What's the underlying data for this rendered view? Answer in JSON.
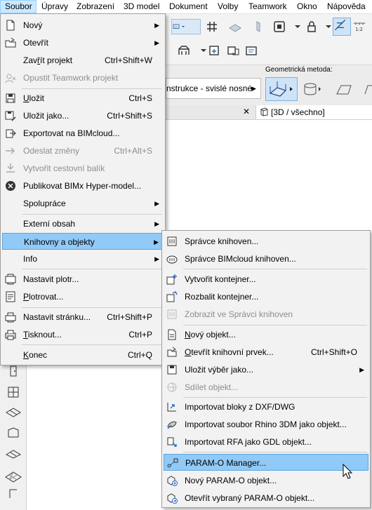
{
  "menubar": {
    "items": [
      "Soubor",
      "Úpravy",
      "Zobrazení",
      "3D model",
      "Dokument",
      "Volby",
      "Teamwork",
      "Okno",
      "Nápověda"
    ]
  },
  "infobox": {
    "construction_label": "nstrukce - svislé nosné",
    "geometry_method_label": "Geometrická metoda:"
  },
  "tabbar": {
    "view_tab": "[3D / všechno]"
  },
  "file_menu": {
    "items": [
      {
        "label": "Nový",
        "shortcut": "",
        "submenu": true,
        "disabled": false
      },
      {
        "label": "Otevřít",
        "shortcut": "",
        "submenu": true,
        "disabled": false
      },
      {
        "label": "Zavřít projekt",
        "shortcut": "Ctrl+Shift+W",
        "submenu": false,
        "disabled": false
      },
      {
        "label": "Opustit Teamwork projekt",
        "shortcut": "",
        "submenu": false,
        "disabled": true
      },
      {
        "label": "Uložit",
        "shortcut": "Ctrl+S",
        "submenu": false,
        "disabled": false
      },
      {
        "label": "Uložit jako...",
        "shortcut": "Ctrl+Shift+S",
        "submenu": false,
        "disabled": false
      },
      {
        "label": "Exportovat na BIMcloud...",
        "shortcut": "",
        "submenu": false,
        "disabled": false
      },
      {
        "label": "Odeslat změny",
        "shortcut": "Ctrl+Alt+S",
        "submenu": false,
        "disabled": true
      },
      {
        "label": "Vytvořit cestovní balík",
        "shortcut": "",
        "submenu": false,
        "disabled": true
      },
      {
        "label": "Publikovat BIMx Hyper-model...",
        "shortcut": "",
        "submenu": false,
        "disabled": false
      },
      {
        "label": "Spolupráce",
        "shortcut": "",
        "submenu": true,
        "disabled": false
      },
      {
        "label": "Externí obsah",
        "shortcut": "",
        "submenu": true,
        "disabled": false
      },
      {
        "label": "Knihovny a objekty",
        "shortcut": "",
        "submenu": true,
        "disabled": false
      },
      {
        "label": "Info",
        "shortcut": "",
        "submenu": true,
        "disabled": false
      },
      {
        "label": "Nastavit plotr...",
        "shortcut": "",
        "submenu": false,
        "disabled": false
      },
      {
        "label": "Plotrovat...",
        "shortcut": "",
        "submenu": false,
        "disabled": false
      },
      {
        "label": "Nastavit stránku...",
        "shortcut": "Ctrl+Shift+P",
        "submenu": false,
        "disabled": false
      },
      {
        "label": "Tisknout...",
        "shortcut": "Ctrl+P",
        "submenu": false,
        "disabled": false
      },
      {
        "label": "Konec",
        "shortcut": "Ctrl+Q",
        "submenu": false,
        "disabled": false
      }
    ]
  },
  "library_menu": {
    "items": [
      {
        "label": "Správce knihoven...",
        "shortcut": "",
        "submenu": false,
        "disabled": false
      },
      {
        "label": "Správce BIMcloud knihoven...",
        "shortcut": "",
        "submenu": false,
        "disabled": false
      },
      {
        "label": "Vytvořit kontejner...",
        "shortcut": "",
        "submenu": false,
        "disabled": false
      },
      {
        "label": "Rozbalit kontejner...",
        "shortcut": "",
        "submenu": false,
        "disabled": false
      },
      {
        "label": "Zobrazit ve Správci knihoven",
        "shortcut": "",
        "submenu": false,
        "disabled": true
      },
      {
        "label": "Nový objekt...",
        "shortcut": "",
        "submenu": false,
        "disabled": false
      },
      {
        "label": "Otevřít knihovní prvek...",
        "shortcut": "Ctrl+Shift+O",
        "submenu": false,
        "disabled": false
      },
      {
        "label": "Uložit výběr jako...",
        "shortcut": "",
        "submenu": true,
        "disabled": false
      },
      {
        "label": "Sdílet objekt...",
        "shortcut": "",
        "submenu": false,
        "disabled": true
      },
      {
        "label": "Importovat bloky z DXF/DWG",
        "shortcut": "",
        "submenu": false,
        "disabled": false
      },
      {
        "label": "Importovat soubor Rhino 3DM jako objekt...",
        "shortcut": "",
        "submenu": false,
        "disabled": false
      },
      {
        "label": "Importovat RFA jako GDL objekt...",
        "shortcut": "",
        "submenu": false,
        "disabled": false
      },
      {
        "label": "PARAM-O Manager...",
        "shortcut": "",
        "submenu": false,
        "disabled": false
      },
      {
        "label": "Nový PARAM-O objekt...",
        "shortcut": "",
        "submenu": false,
        "disabled": false
      },
      {
        "label": "Otevřít vybraný PARAM-O objekt...",
        "shortcut": "",
        "submenu": false,
        "disabled": false
      }
    ]
  },
  "colors": {
    "highlight": "#91c9f7",
    "highlight_border": "#5ba6e0",
    "menubar_active": "#cce8ff",
    "disabled_text": "#8d8d8d"
  }
}
